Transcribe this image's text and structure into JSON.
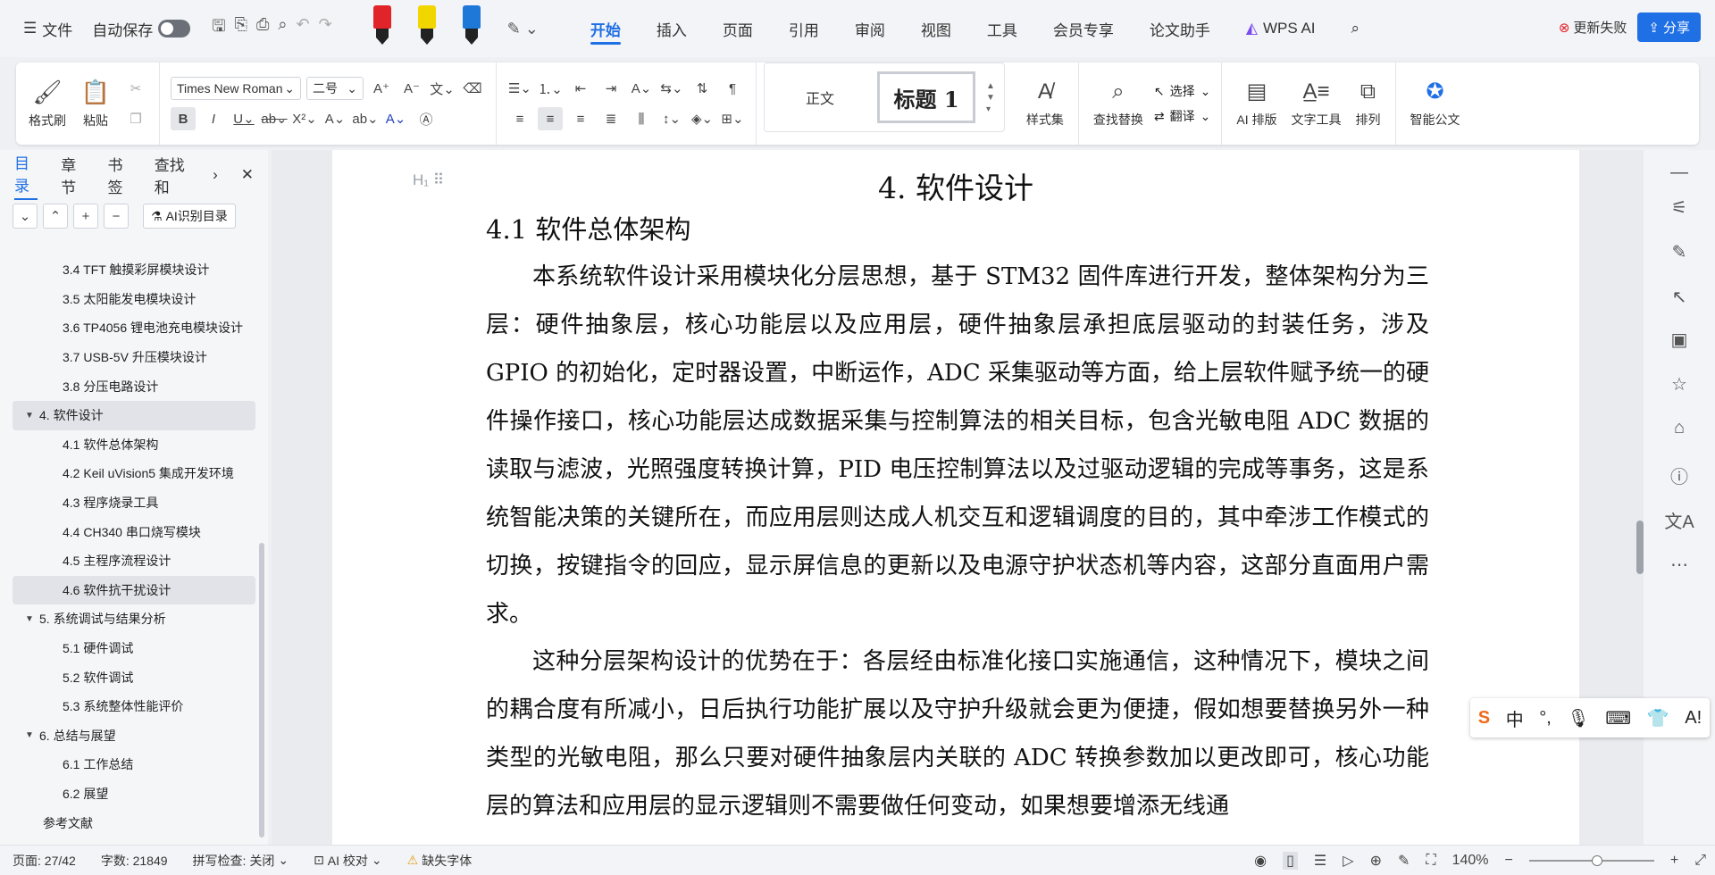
{
  "menubar": {
    "menu_label": "文件",
    "autosave_label": "自动保存",
    "tabs": [
      "开始",
      "插入",
      "页面",
      "引用",
      "审阅",
      "视图",
      "工具",
      "会员专享",
      "论文助手"
    ],
    "wps_ai": "WPS AI",
    "update_label": "更新失败",
    "share_label": "分享"
  },
  "ribbon": {
    "format_painter": "格式刷",
    "paste": "粘贴",
    "font_name": "Times New Roman",
    "font_size": "二号",
    "style_normal": "正文",
    "style_heading1": "标题 1",
    "styles_set": "样式集",
    "find_replace": "查找替换",
    "select": "选择",
    "translate": "翻译",
    "ai_layout": "AI 排版",
    "text_tools": "文字工具",
    "arrange": "排列",
    "smart_doc": "智能公文"
  },
  "nav": {
    "tabs": [
      "目录",
      "章节",
      "书签",
      "查找和"
    ],
    "ai_toc": "AI识别目录",
    "toc": [
      {
        "label": "3.4 TFT 触摸彩屏模块设计",
        "level": 2
      },
      {
        "label": "3.5 太阳能发电模块设计",
        "level": 2
      },
      {
        "label": "3.6 TP4056 锂电池充电模块设计",
        "level": 2
      },
      {
        "label": "3.7 USB-5V 升压模块设计",
        "level": 2
      },
      {
        "label": "3.8 分压电路设计",
        "level": 2
      },
      {
        "label": "4. 软件设计",
        "level": 1
      },
      {
        "label": "4.1 软件总体架构",
        "level": 2
      },
      {
        "label": "4.2 Keil uVision5 集成开发环境",
        "level": 2
      },
      {
        "label": "4.3 程序烧录工具",
        "level": 2
      },
      {
        "label": "4.4 CH340 串口烧写模块",
        "level": 2
      },
      {
        "label": "4.5 主程序流程设计",
        "level": 2
      },
      {
        "label": "4.6 软件抗干扰设计",
        "level": 2
      },
      {
        "label": "5. 系统调试与结果分析",
        "level": 1
      },
      {
        "label": "5.1 硬件调试",
        "level": 2
      },
      {
        "label": "5.2 软件调试",
        "level": 2
      },
      {
        "label": "5.3 系统整体性能评价",
        "level": 2
      },
      {
        "label": "6. 总结与展望",
        "level": 1
      },
      {
        "label": "6.1 工作总结",
        "level": 2
      },
      {
        "label": "6.2 展望",
        "level": 2
      },
      {
        "label": "参考文献",
        "level": 0
      }
    ]
  },
  "document": {
    "heading1": "4.  软件设计",
    "heading2": "4.1  软件总体架构",
    "paragraph1": "本系统软件设计采用模块化分层思想，基于 STM32 固件库进行开发，整体架构分为三层：硬件抽象层，核心功能层以及应用层，硬件抽象层承担底层驱动的封装任务，涉及 GPIO 的初始化，定时器设置，中断运作，ADC 采集驱动等方面，给上层软件赋予统一的硬件操作接口，核心功能层达成数据采集与控制算法的相关目标，包含光敏电阻 ADC 数据的读取与滤波，光照强度转换计算，PID 电压控制算法以及过驱动逻辑的完成等事务，这是系统智能决策的关键所在，而应用层则达成人机交互和逻辑调度的目的，其中牵涉工作模式的切换，按键指令的回应，显示屏信息的更新以及电源守护状态机等内容，这部分直面用户需求。",
    "paragraph2": "这种分层架构设计的优势在于：各层经由标准化接口实施通信，这种情况下，模块之间的耦合度有所减小，日后执行功能扩展以及守护升级就会更为便捷，假如想要替换另外一种类型的光敏电阻，那么只要对硬件抽象层内关联的 ADC 转换参数加以更改即可，核心功能层的算法和应用层的显示逻辑则不需要做任何变动，如果想要增添无线通"
  },
  "ime": {
    "lang": "中"
  },
  "status": {
    "page": "页面: 27/42",
    "words": "字数: 21849",
    "spell": "拼写检查: 关闭",
    "ai_proof": "AI 校对",
    "missing_font": "缺失字体",
    "zoom": "140%"
  },
  "colors": {
    "accent": "#1f6fe5",
    "pen_red": "#e0242a",
    "pen_yellow": "#f2d600",
    "pen_blue": "#1e78d8"
  }
}
